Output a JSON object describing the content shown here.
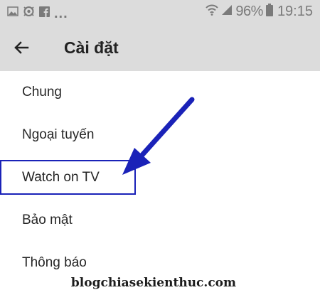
{
  "status_bar": {
    "left_icons": [
      "image-icon",
      "app-icon",
      "facebook-icon"
    ],
    "overflow": "...",
    "battery": "96%",
    "time": "19:15",
    "right_icons": [
      "wifi-icon",
      "signal-icon",
      "battery-icon"
    ]
  },
  "app_bar": {
    "back_icon": "arrow-left-icon",
    "title": "Cài đặt"
  },
  "settings": {
    "items": [
      {
        "label": "Chung"
      },
      {
        "label": "Ngoại tuyến"
      },
      {
        "label": "Watch on TV"
      },
      {
        "label": "Bảo mật"
      },
      {
        "label": "Thông báo"
      }
    ]
  },
  "annotation": {
    "color": "#1a22b8"
  },
  "watermark": {
    "text": "blogchiasekienthuc.com"
  },
  "colors": {
    "app_bar_bg": "#dcdcdc",
    "status_text": "#7a7a7a",
    "annotation": "#1a22b8"
  }
}
